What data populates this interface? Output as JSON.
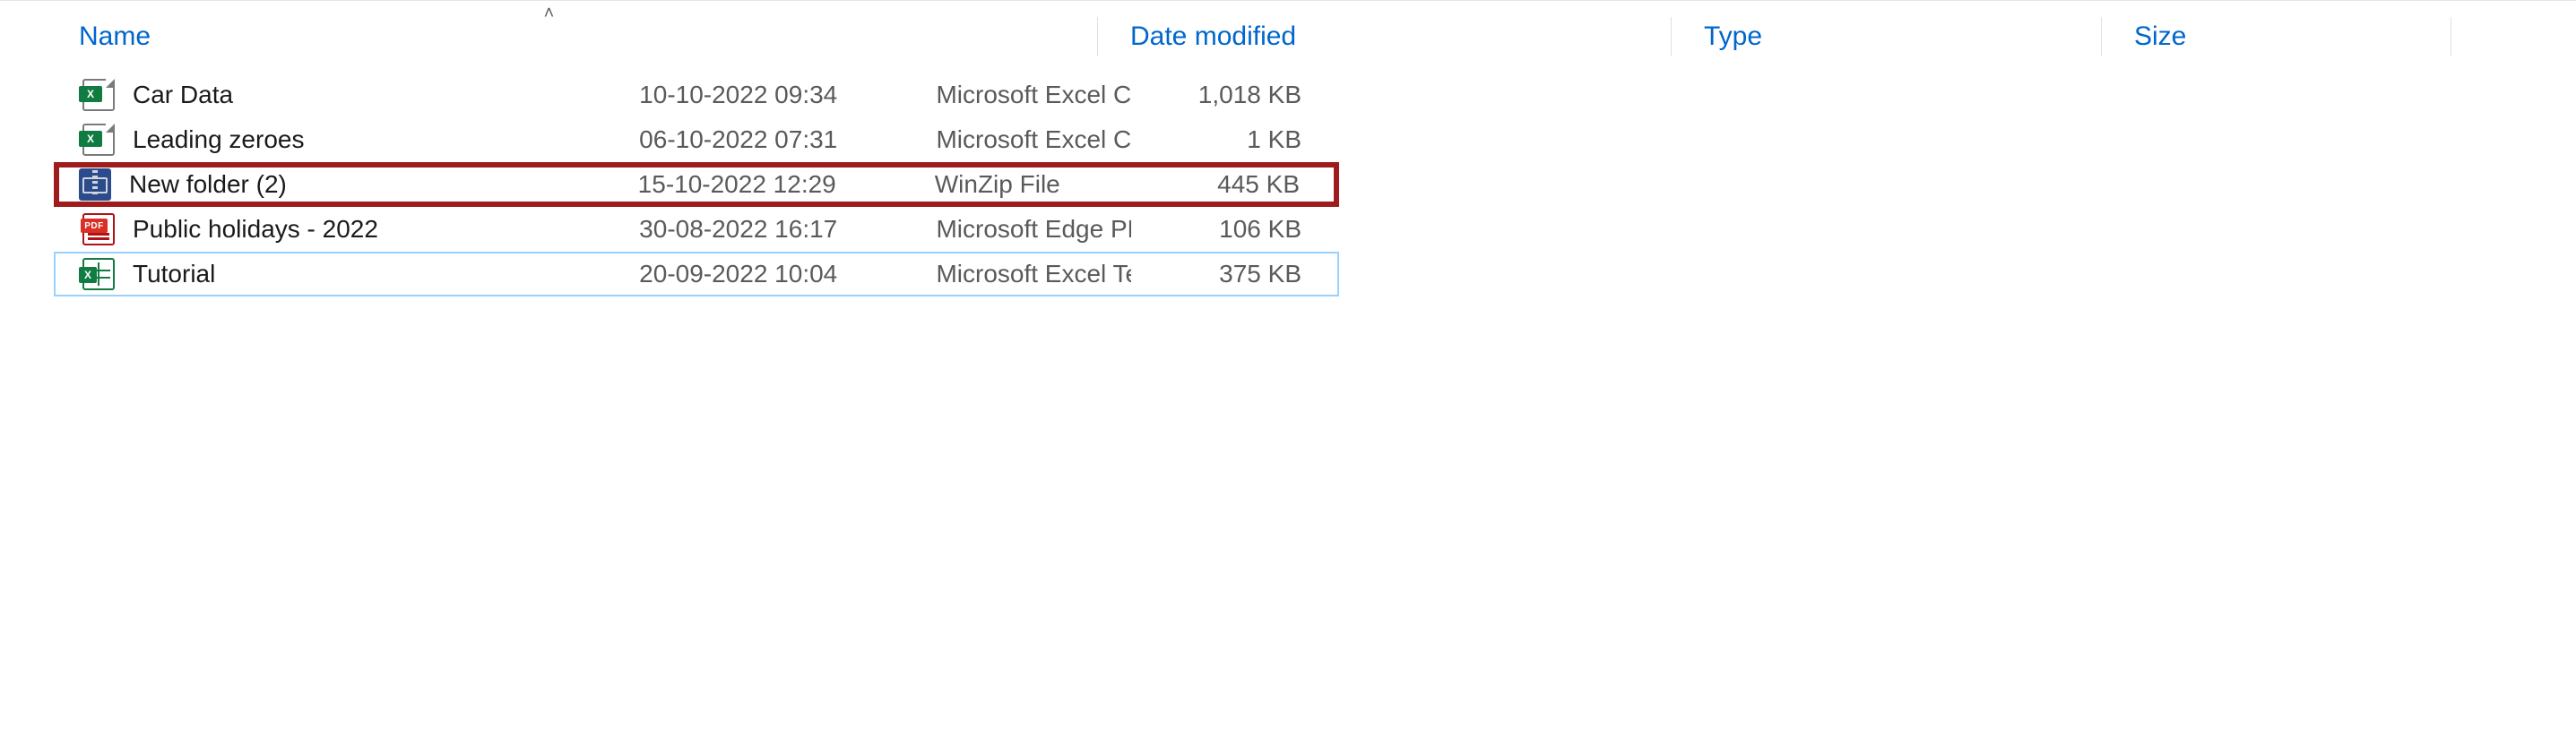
{
  "columns": {
    "name": "Name",
    "date": "Date modified",
    "type": "Type",
    "size": "Size"
  },
  "sort": {
    "column": "name",
    "direction": "asc"
  },
  "files": [
    {
      "icon": "excel-csv",
      "name": "Car Data",
      "date": "10-10-2022 09:34",
      "type": "Microsoft Excel Co…",
      "size": "1,018 KB",
      "highlighted": false,
      "selected": false
    },
    {
      "icon": "excel-csv",
      "name": "Leading zeroes",
      "date": "06-10-2022 07:31",
      "type": "Microsoft Excel Co…",
      "size": "1 KB",
      "highlighted": false,
      "selected": false
    },
    {
      "icon": "zip",
      "name": "New folder (2)",
      "date": "15-10-2022 12:29",
      "type": "WinZip File",
      "size": "445 KB",
      "highlighted": true,
      "selected": false
    },
    {
      "icon": "pdf",
      "name": "Public holidays - 2022",
      "date": "30-08-2022 16:17",
      "type": "Microsoft Edge PD…",
      "size": "106 KB",
      "highlighted": false,
      "selected": false
    },
    {
      "icon": "excel-tpl",
      "name": "Tutorial",
      "date": "20-09-2022 10:04",
      "type": "Microsoft Excel Te…",
      "size": "375 KB",
      "highlighted": false,
      "selected": true
    }
  ]
}
